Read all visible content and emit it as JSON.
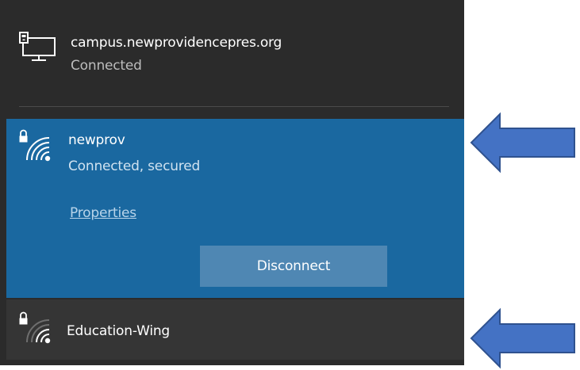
{
  "networks": {
    "wired": {
      "name": "campus.newprovidencepres.org",
      "status": "Connected",
      "icon": "ethernet-monitor-icon"
    },
    "selected_wifi": {
      "name": "newprov",
      "status": "Connected, secured",
      "properties_label": "Properties",
      "disconnect_label": "Disconnect",
      "icon": "wifi-secured-icon",
      "signal_level": 1.0
    },
    "other_wifi": {
      "name": "Education-Wing",
      "icon": "wifi-secured-icon",
      "signal_level": 0.5
    }
  },
  "colors": {
    "panel_bg": "#2b2b2b",
    "selected_bg": "#1a68a0",
    "button_bg": "#4f87b3",
    "arrow_fill": "#4472c4",
    "arrow_stroke": "#2f528f"
  },
  "annotations": {
    "arrow_count": 2,
    "arrow_icon": "left-arrow-icon"
  }
}
